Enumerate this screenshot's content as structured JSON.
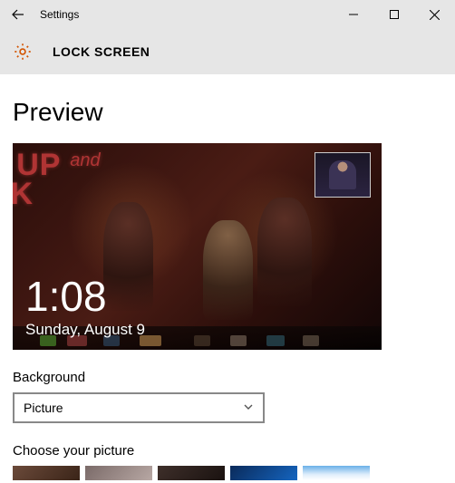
{
  "window": {
    "title": "Settings"
  },
  "page": {
    "heading": "LOCK SCREEN",
    "preview_label": "Preview",
    "background_label": "Background",
    "choose_label": "Choose your picture"
  },
  "preview": {
    "time": "1:08",
    "date": "Sunday, August 9",
    "sign_line1": "T UP",
    "sign_and": "and",
    "sign_line2": "NK"
  },
  "background_select": {
    "value": "Picture"
  }
}
